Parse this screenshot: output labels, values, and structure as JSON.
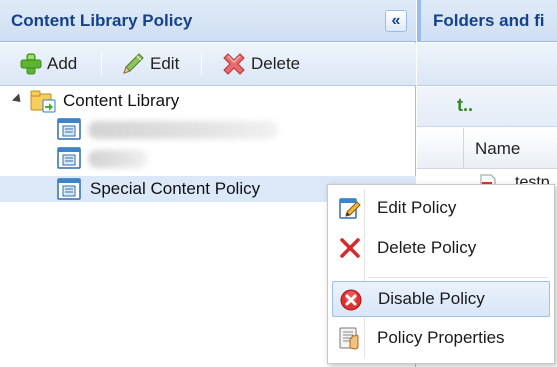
{
  "left_panel": {
    "title": "Content Library Policy",
    "collapse_glyph": "«",
    "toolbar": {
      "add_label": "Add",
      "edit_label": "Edit",
      "delete_label": "Delete"
    },
    "tree": {
      "root_label": "Content Library",
      "children": [
        {
          "label": ""
        },
        {
          "label": ""
        },
        {
          "label": "Special Content Policy"
        }
      ]
    }
  },
  "right_panel": {
    "title": "Folders and fi",
    "up_glyph": "t..",
    "grid": {
      "column_name": "Name",
      "rows": [
        {
          "name": "testp"
        }
      ]
    }
  },
  "context_menu": {
    "items": [
      {
        "label": "Edit Policy",
        "icon": "edit-policy-icon"
      },
      {
        "label": "Delete Policy",
        "icon": "delete-x-icon"
      },
      {
        "label": "Disable Policy",
        "icon": "disable-icon"
      },
      {
        "label": "Policy Properties",
        "icon": "properties-icon"
      }
    ]
  },
  "colors": {
    "header_text": "#15428b",
    "panel_border": "#99bce8",
    "selection": "#dbe8f8"
  }
}
